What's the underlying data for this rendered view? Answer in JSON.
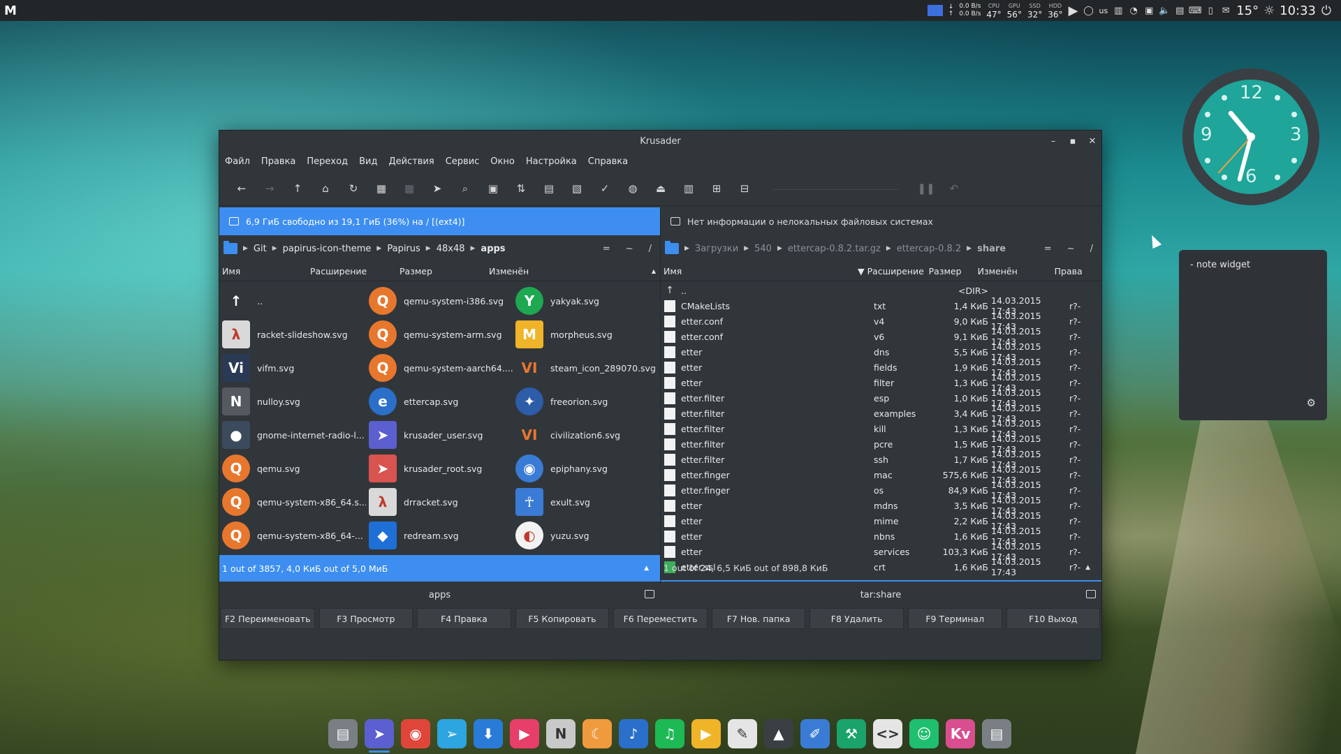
{
  "top_panel": {
    "launcher": "M",
    "net_down_arrow": "↓",
    "net_up_arrow": "↑",
    "net_down": "0.0 B/s",
    "net_up": "0.0 B/s",
    "sensors": [
      {
        "label": "CPU",
        "value": "47°"
      },
      {
        "label": "GPU",
        "value": "56°"
      },
      {
        "label": "SSD",
        "value": "32°"
      },
      {
        "label": "HDD",
        "value": "36°"
      }
    ],
    "keyboard_layout": "us",
    "weather": "15°",
    "time": "10:33"
  },
  "window": {
    "title": "Krusader",
    "menu": [
      "Файл",
      "Правка",
      "Переход",
      "Вид",
      "Действия",
      "Сервис",
      "Окно",
      "Настройка",
      "Справка"
    ],
    "left_panel": {
      "free_space": "6,9 ГиБ свободно из 19,1 ГиБ (36%) на / [(ext4)]",
      "breadcrumb": [
        "Git",
        "papirus-icon-theme",
        "Papirus",
        "48x48"
      ],
      "current": "apps",
      "crumb_controls": [
        "=",
        "~",
        "/"
      ],
      "columns": [
        "Имя",
        "Расширение",
        "Размер",
        "Изменён"
      ],
      "items": [
        {
          "name": "..",
          "icon": "up-arrow-icon",
          "color": "#31363b",
          "glyph": "↑"
        },
        {
          "name": "qemu-system-i386.svg",
          "icon": "qemu-icon",
          "color": "#e8772e",
          "glyph": "Q"
        },
        {
          "name": "yakyak.svg",
          "icon": "yakyak-icon",
          "color": "#1da851",
          "glyph": "Y"
        },
        {
          "name": "racket-slideshow.svg",
          "icon": "racket-slideshow-icon",
          "color": "#d9d9d9",
          "glyph": "λ"
        },
        {
          "name": "qemu-system-arm.svg",
          "icon": "qemu-icon",
          "color": "#e8772e",
          "glyph": "Q"
        },
        {
          "name": "morpheus.svg",
          "icon": "morpheus-icon",
          "color": "#f0b429",
          "glyph": "M"
        },
        {
          "name": "vifm.svg",
          "icon": "vifm-icon",
          "color": "#2a3a55",
          "glyph": "Vi"
        },
        {
          "name": "qemu-system-aarch64....",
          "icon": "qemu-icon",
          "color": "#e8772e",
          "glyph": "Q"
        },
        {
          "name": "steam_icon_289070.svg",
          "icon": "civilization-icon",
          "color": "#31363b",
          "glyph": "VI"
        },
        {
          "name": "nulloy.svg",
          "icon": "nulloy-icon",
          "color": "#555a60",
          "glyph": "N"
        },
        {
          "name": "ettercap.svg",
          "icon": "ettercap-icon",
          "color": "#2a6fc9",
          "glyph": "e"
        },
        {
          "name": "freeorion.svg",
          "icon": "freeorion-icon",
          "color": "#2d5ca8",
          "glyph": "✦"
        },
        {
          "name": "gnome-internet-radio-l...",
          "icon": "radio-icon",
          "color": "#3b4a5c",
          "glyph": "●"
        },
        {
          "name": "krusader_user.svg",
          "icon": "krusader-user-icon",
          "color": "#5b5fcf",
          "glyph": "➤"
        },
        {
          "name": "civilization6.svg",
          "icon": "civilization-icon",
          "color": "#31363b",
          "glyph": "VI"
        },
        {
          "name": "qemu.svg",
          "icon": "qemu-icon",
          "color": "#e8772e",
          "glyph": "Q"
        },
        {
          "name": "krusader_root.svg",
          "icon": "krusader-root-icon",
          "color": "#d9534f",
          "glyph": "➤"
        },
        {
          "name": "epiphany.svg",
          "icon": "epiphany-icon",
          "color": "#3a7bd5",
          "glyph": "◉"
        },
        {
          "name": "qemu-system-x86_64.s...",
          "icon": "qemu-icon",
          "color": "#e8772e",
          "glyph": "Q"
        },
        {
          "name": "drracket.svg",
          "icon": "drracket-icon",
          "color": "#d9d9d9",
          "glyph": "λ"
        },
        {
          "name": "exult.svg",
          "icon": "exult-icon",
          "color": "#3a7bd5",
          "glyph": "☥"
        },
        {
          "name": "qemu-system-x86_64-...",
          "icon": "qemu-icon",
          "color": "#e8772e",
          "glyph": "Q"
        },
        {
          "name": "redream.svg",
          "icon": "redream-icon",
          "color": "#1e6fd6",
          "glyph": "◆"
        },
        {
          "name": "yuzu.svg",
          "icon": "yuzu-icon",
          "color": "#f2f2f2",
          "glyph": "◐"
        }
      ],
      "status": "1 out of 3857, 4,0 КиБ out of 5,0 МиБ",
      "tab": "apps"
    },
    "right_panel": {
      "free_space": "Нет информации о нелокальных файловых системах",
      "breadcrumb": [
        "Загрузки",
        "540",
        "ettercap-0.8.2.tar.gz",
        "ettercap-0.8.2"
      ],
      "current": "share",
      "crumb_controls": [
        "=",
        "~",
        "/"
      ],
      "columns": [
        "Имя",
        "Расширение",
        "Размер",
        "Изменён",
        "Права"
      ],
      "rows": [
        {
          "name": "..",
          "ext": "",
          "size": "<DIR>",
          "date": "",
          "perm": "",
          "kind": "up"
        },
        {
          "name": "CMakeLists",
          "ext": "txt",
          "size": "1,4 КиБ",
          "date": "14.03.2015 17:43",
          "perm": "r?-",
          "kind": "cmake"
        },
        {
          "name": "etter.conf",
          "ext": "v4",
          "size": "9,0 КиБ",
          "date": "14.03.2015 17:43",
          "perm": "r?-",
          "kind": "file"
        },
        {
          "name": "etter.conf",
          "ext": "v6",
          "size": "9,1 КиБ",
          "date": "14.03.2015 17:43",
          "perm": "r?-",
          "kind": "file"
        },
        {
          "name": "etter",
          "ext": "dns",
          "size": "5,5 КиБ",
          "date": "14.03.2015 17:43",
          "perm": "r?-",
          "kind": "file"
        },
        {
          "name": "etter",
          "ext": "fields",
          "size": "1,9 КиБ",
          "date": "14.03.2015 17:43",
          "perm": "r?-",
          "kind": "file"
        },
        {
          "name": "etter",
          "ext": "filter",
          "size": "1,3 КиБ",
          "date": "14.03.2015 17:43",
          "perm": "r?-",
          "kind": "file"
        },
        {
          "name": "etter.filter",
          "ext": "esp",
          "size": "1,0 КиБ",
          "date": "14.03.2015 17:43",
          "perm": "r?-",
          "kind": "file"
        },
        {
          "name": "etter.filter",
          "ext": "examples",
          "size": "3,4 КиБ",
          "date": "14.03.2015 17:43",
          "perm": "r?-",
          "kind": "file"
        },
        {
          "name": "etter.filter",
          "ext": "kill",
          "size": "1,3 КиБ",
          "date": "14.03.2015 17:43",
          "perm": "r?-",
          "kind": "file"
        },
        {
          "name": "etter.filter",
          "ext": "pcre",
          "size": "1,5 КиБ",
          "date": "14.03.2015 17:43",
          "perm": "r?-",
          "kind": "file"
        },
        {
          "name": "etter.filter",
          "ext": "ssh",
          "size": "1,7 КиБ",
          "date": "14.03.2015 17:43",
          "perm": "r?-",
          "kind": "file"
        },
        {
          "name": "etter.finger",
          "ext": "mac",
          "size": "575,6 КиБ",
          "date": "14.03.2015 17:43",
          "perm": "r?-",
          "kind": "file"
        },
        {
          "name": "etter.finger",
          "ext": "os",
          "size": "84,9 КиБ",
          "date": "14.03.2015 17:43",
          "perm": "r?-",
          "kind": "file"
        },
        {
          "name": "etter",
          "ext": "mdns",
          "size": "3,5 КиБ",
          "date": "14.03.2015 17:43",
          "perm": "r?-",
          "kind": "file"
        },
        {
          "name": "etter",
          "ext": "mime",
          "size": "2,2 КиБ",
          "date": "14.03.2015 17:43",
          "perm": "r?-",
          "kind": "file"
        },
        {
          "name": "etter",
          "ext": "nbns",
          "size": "1,6 КиБ",
          "date": "14.03.2015 17:43",
          "perm": "r?-",
          "kind": "file"
        },
        {
          "name": "etter",
          "ext": "services",
          "size": "103,3 КиБ",
          "date": "14.03.2015 17:43",
          "perm": "r?-",
          "kind": "file"
        },
        {
          "name": "etter.ssl",
          "ext": "crt",
          "size": "1,6 КиБ",
          "date": "14.03.2015 17:43",
          "perm": "r?-",
          "kind": "ssl"
        }
      ],
      "status": "1 out of 24, 6,5 КиБ out of 898,8 КиБ",
      "tab": "tar:share"
    },
    "fkeys": [
      "F2 Переименовать",
      "F3 Просмотр",
      "F4 Правка",
      "F5 Копировать",
      "F6 Переместить",
      "F7 Нов. папка",
      "F8 Удалить",
      "F9 Терминал",
      "F10 Выход"
    ]
  },
  "clock": {
    "numbers": [
      "12",
      "3",
      "6",
      "9"
    ],
    "face_color": "#1fa59a"
  },
  "note_widget": {
    "text": "- note widget"
  },
  "dock": [
    {
      "icon": "file-manager-icon",
      "color": "#7a7f85",
      "glyph": "▤"
    },
    {
      "icon": "krusader-icon",
      "color": "#5b5fcf",
      "glyph": "➤"
    },
    {
      "icon": "chrome-icon",
      "color": "#e0453a",
      "glyph": "◉"
    },
    {
      "icon": "telegram-icon",
      "color": "#2ca5e0",
      "glyph": "➢"
    },
    {
      "icon": "download-icon",
      "color": "#2a7bd8",
      "glyph": "⬇"
    },
    {
      "icon": "media-player-icon",
      "color": "#e83e6a",
      "glyph": "▶"
    },
    {
      "icon": "nulloy-icon",
      "color": "#c9c9c9",
      "glyph": "N"
    },
    {
      "icon": "moon-icon",
      "color": "#f09a3e",
      "glyph": "☾"
    },
    {
      "icon": "music-icon",
      "color": "#2a6fc9",
      "glyph": "♪"
    },
    {
      "icon": "spotify-icon",
      "color": "#1db954",
      "glyph": "♫"
    },
    {
      "icon": "play-icon",
      "color": "#f0b429",
      "glyph": "▶"
    },
    {
      "icon": "editor-icon",
      "color": "#e5e5e5",
      "glyph": "✎"
    },
    {
      "icon": "inkscape-icon",
      "color": "#3a3f44",
      "glyph": "▲"
    },
    {
      "icon": "color-picker-icon",
      "color": "#3a7bd5",
      "glyph": "✐"
    },
    {
      "icon": "wrench-icon",
      "color": "#1aa36a",
      "glyph": "⚒"
    },
    {
      "icon": "code-icon",
      "color": "#e5e5e5",
      "glyph": "<>"
    },
    {
      "icon": "ghost-icon",
      "color": "#1fbf6f",
      "glyph": "☺"
    },
    {
      "icon": "kv-icon",
      "color": "#d94e8f",
      "glyph": "Kv"
    },
    {
      "icon": "files-icon",
      "color": "#7a7f85",
      "glyph": "▤"
    }
  ]
}
